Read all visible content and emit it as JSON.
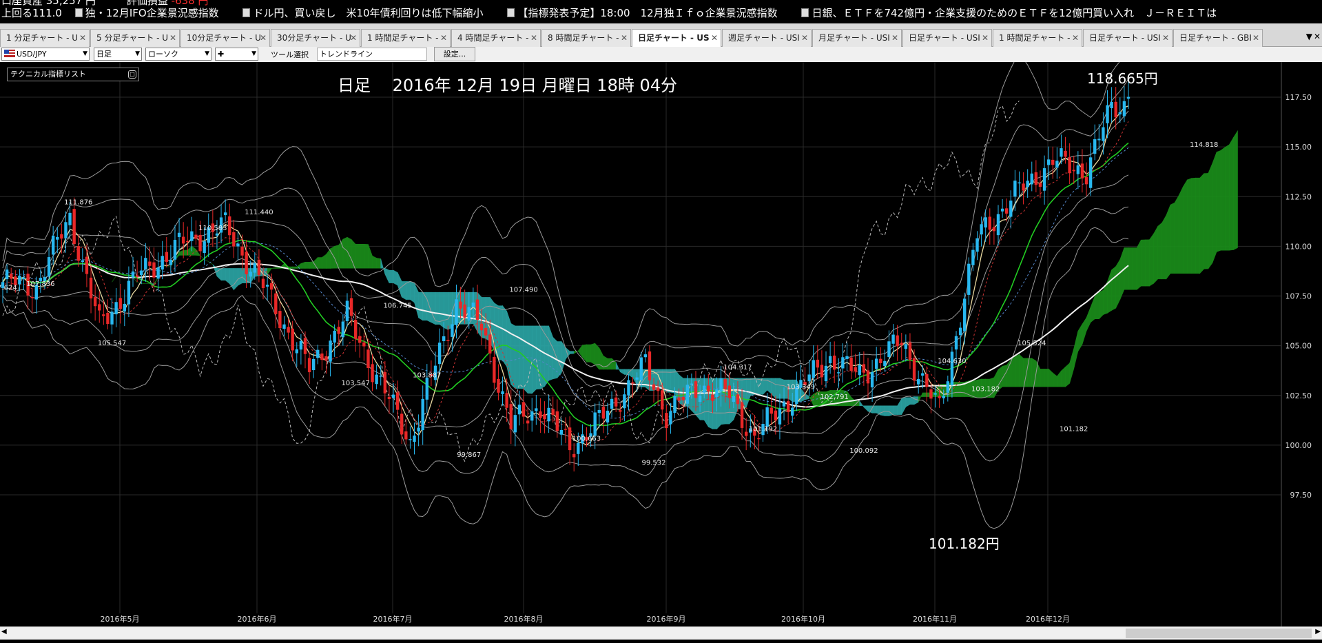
{
  "ticker": {
    "account_label": "口座資産 35,257 円",
    "pnl_label": "評価損益",
    "pnl_value": "-638 円",
    "row2_lead": "上回る111.0",
    "news": [
      "独・12月IFO企業景況感指数",
      "ドル円、買い戻し　米10年債利回りは低下幅縮小",
      "【指標発表予定】18:00　12月独Ｉｆｏ企業景況感指数",
      "日銀、ＥＴＦを742億円・企業支援のためのＥＴＦを12億円買い入れ　Ｊ－ＲＥＩＴは"
    ]
  },
  "tabs": [
    {
      "label": "1 分足チャート - U",
      "active": false
    },
    {
      "label": "5 分足チャート - U",
      "active": false
    },
    {
      "label": "10分足チャート - U",
      "active": false
    },
    {
      "label": "30分足チャート - U",
      "active": false
    },
    {
      "label": "1 時間足チャート -",
      "active": false
    },
    {
      "label": "4 時間足チャート -",
      "active": false
    },
    {
      "label": "8 時間足チャート -",
      "active": false
    },
    {
      "label": "日足チャート - US",
      "active": true
    },
    {
      "label": "週足チャート - USI",
      "active": false
    },
    {
      "label": "月足チャート - USI",
      "active": false
    },
    {
      "label": "日足チャート - USI",
      "active": false
    },
    {
      "label": "1 時間足チャート -",
      "active": false
    },
    {
      "label": "日足チャート - USI",
      "active": false
    },
    {
      "label": "日足チャート - GBI",
      "active": false
    }
  ],
  "toolbar": {
    "pair": "USD/JPY",
    "timeframe": "日足",
    "chart_type": "ローソク",
    "cursor_mode": "✚",
    "tool_label": "ツール選択",
    "tool_value": "トレンドライン",
    "settings_button": "設定..."
  },
  "chart": {
    "indicator_list": "テクニカル指標リスト",
    "title": "日足　 2016年 12月 19日 月曜日 18時 04分",
    "high_label": "118.665円",
    "low_label": "101.182円"
  },
  "chart_data": {
    "type": "candlestick",
    "symbol": "USD/JPY",
    "timeframe": "daily",
    "ylim": [
      97.5,
      120.0
    ],
    "yticks": [
      "117.50",
      "115.00",
      "112.50",
      "110.00",
      "107.50",
      "105.00",
      "102.50",
      "100.00",
      "97.50"
    ],
    "xticks": [
      "2016年5月",
      "2016年6月",
      "2016年7月",
      "2016年8月",
      "2016年9月",
      "2016年10月",
      "2016年11月",
      "2016年12月"
    ],
    "annotations": [
      {
        "text": "107.624",
        "price": 107.6,
        "date_index": 0
      },
      {
        "text": "107.836",
        "price": 107.8,
        "date_index": 8
      },
      {
        "text": "111.876",
        "price": 111.9,
        "date_index": 16
      },
      {
        "text": "105.547",
        "price": 105.5,
        "date_index": 23
      },
      {
        "text": "110.583",
        "price": 110.6,
        "date_index": 44
      },
      {
        "text": "111.440",
        "price": 111.4,
        "date_index": 53
      },
      {
        "text": "103.547",
        "price": 103.5,
        "date_index": 73
      },
      {
        "text": "106.745",
        "price": 106.7,
        "date_index": 82
      },
      {
        "text": "103.887",
        "price": 103.9,
        "date_index": 88
      },
      {
        "text": "99.867",
        "price": 99.9,
        "date_index": 97
      },
      {
        "text": "107.490",
        "price": 107.5,
        "date_index": 108
      },
      {
        "text": "100.663",
        "price": 100.7,
        "date_index": 121
      },
      {
        "text": "99.532",
        "price": 99.5,
        "date_index": 135
      },
      {
        "text": "104.317",
        "price": 104.3,
        "date_index": 153
      },
      {
        "text": "101.192",
        "price": 101.2,
        "date_index": 158
      },
      {
        "text": "103.349",
        "price": 103.3,
        "date_index": 166
      },
      {
        "text": "102.791",
        "price": 102.8,
        "date_index": 173
      },
      {
        "text": "100.092",
        "price": 100.1,
        "date_index": 179
      },
      {
        "text": "104.630",
        "price": 104.6,
        "date_index": 197
      },
      {
        "text": "103.182",
        "price": 103.2,
        "date_index": 204
      },
      {
        "text": "105.524",
        "price": 105.5,
        "date_index": 214
      },
      {
        "text": "101.182",
        "price": 101.2,
        "date_index": 223
      },
      {
        "text": "114.818",
        "price": 114.8,
        "date_index": 250
      }
    ],
    "last_high": 118.665,
    "swing_low": 101.182
  }
}
